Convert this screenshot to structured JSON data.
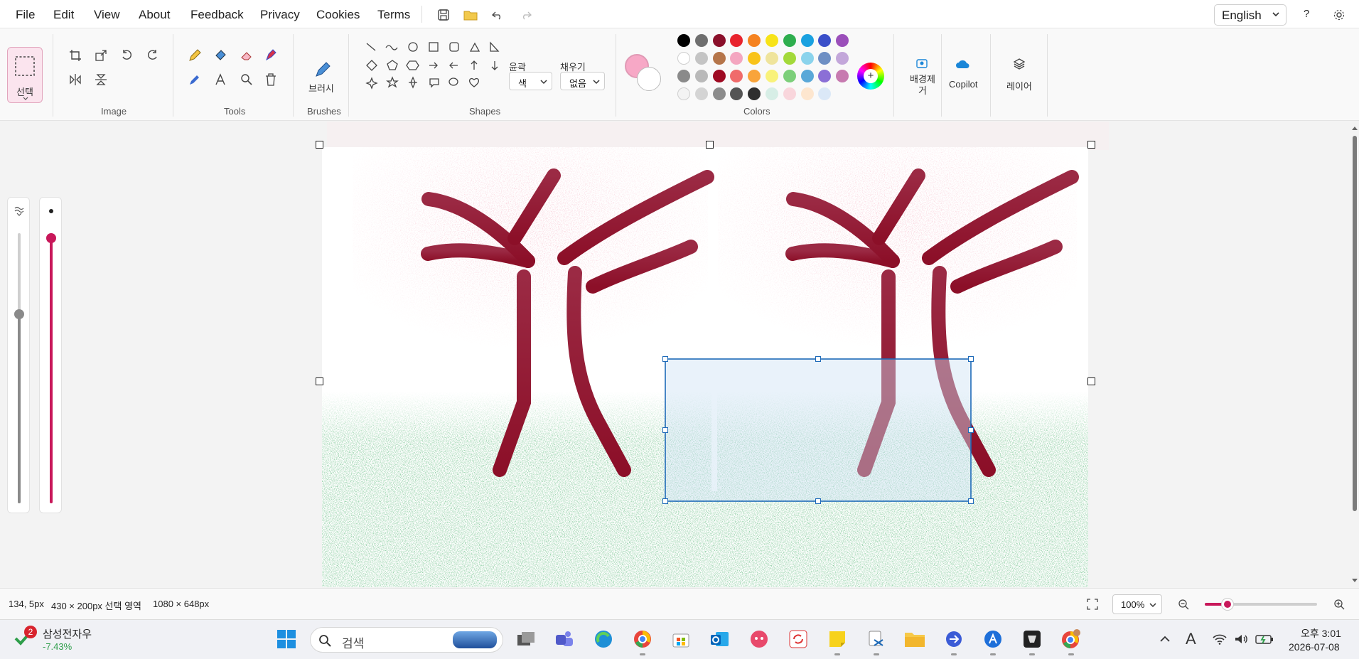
{
  "menu": [
    "File",
    "Edit",
    "View",
    "About",
    "Feedback",
    "Privacy",
    "Cookies",
    "Terms"
  ],
  "language": "English",
  "help_label": "?",
  "ribbon": {
    "select_label": "선택",
    "groups": {
      "image": "Image",
      "tools": "Tools",
      "brushes": "Brushes",
      "shapes": "Shapes",
      "colors": "Colors"
    },
    "brush_label": "브러시",
    "outline_label": "윤곽",
    "outline_value": "색",
    "fill_label": "채우기",
    "fill_value": "없음",
    "bg_remove_label": "배경제거",
    "copilot_label": "Copilot",
    "layers_label": "레이어"
  },
  "palette": [
    [
      "#000000",
      "#6e6e6e",
      "#8a0f2a",
      "#e8232d",
      "#f5821f",
      "#f7e318",
      "#2eae4e",
      "#1aa1e0",
      "#3a4fc9",
      "#9b4fba"
    ],
    [
      "#ffffff",
      "#c4c4c4",
      "#b5754a",
      "#f4a6c0",
      "#f9c31a",
      "#efe49c",
      "#a3d93a",
      "#8ad3ec",
      "#6e8fc4",
      "#c3a7da"
    ],
    [
      "#8a8a8a",
      "#b9b9b9",
      "#9e0a22",
      "#f06b6b",
      "#f9a43a",
      "#f9f27a",
      "#7ccf7a",
      "#5aa8d8",
      "#8b6fd6",
      "#c77ab0"
    ],
    [
      "#f3f3f3",
      "#d4d4d4",
      "#8c8c8c",
      "#545454",
      "#2f2f2f",
      "#d7eee6",
      "#f9d6dc",
      "#fde6cf",
      "#dbe8f7",
      ""
    ]
  ],
  "primary_color": "#f7a8c6",
  "secondary_color": "#ffffff",
  "status": {
    "cursor": "134, 5px",
    "selection": "430 × 200px 선택 영역",
    "canvas_size": "1080 × 648px",
    "zoom": "100%",
    "zoom_fraction": 0.2
  },
  "taskbar": {
    "stock_name": "삼성전자우",
    "stock_change": "-7.43%",
    "notif_count": "2",
    "search_placeholder": "검색",
    "time": "오후 3:01",
    "date": "2026-07-08",
    "ime": "A"
  }
}
